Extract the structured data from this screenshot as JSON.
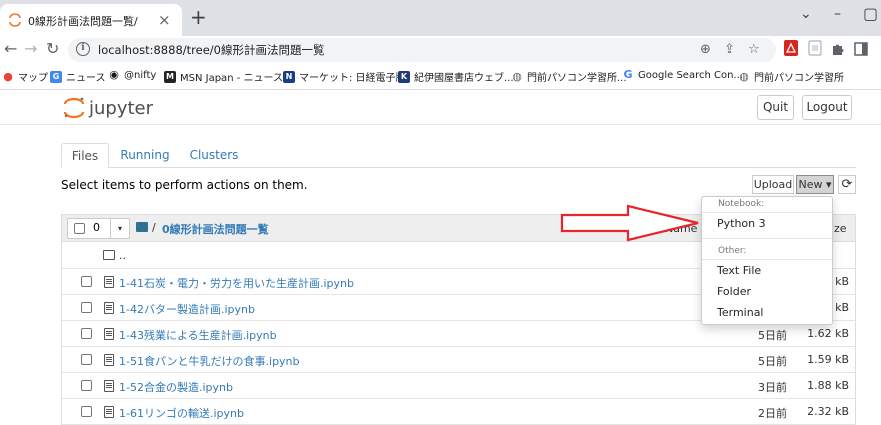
{
  "browser": {
    "tab_title": "0線形計画法問題一覧/",
    "close_glyph": "×",
    "new_tab_glyph": "+",
    "url": "localhost:8888/tree/0線形計画法問題一覧",
    "controls": {
      "minimize": "⌄",
      "minimize2": "–",
      "restore": "▢",
      "close": "×"
    },
    "bookmarks": [
      {
        "label": "マップ",
        "icon": "map-pin-icon",
        "color": "#ea4335"
      },
      {
        "label": "ニュース",
        "icon": "gn-news-icon",
        "color": "#4285f4"
      },
      {
        "label": "@nifty",
        "icon": "nifty-icon",
        "color": "#1a1a1a"
      },
      {
        "label": "MSN Japan - ニュース...",
        "icon": "msn-icon",
        "color": "#222222"
      },
      {
        "label": "マーケット: 日経電子版",
        "icon": "nikkei-icon",
        "color": "#183d8b"
      },
      {
        "label": "紀伊國屋書店ウェブ...",
        "icon": "kinokuniya-icon",
        "color": "#1f3b7a"
      },
      {
        "label": "門前パソコン学習所...",
        "icon": "globe-icon",
        "color": "#5f6368"
      },
      {
        "label": "Google Search Con...",
        "icon": "google-icon",
        "color": "#4285f4"
      },
      {
        "label": "門前パソコン学習所",
        "icon": "globe-icon",
        "color": "#5f6368"
      }
    ]
  },
  "jupyter": {
    "logo_text": "jupyter",
    "quit_label": "Quit",
    "logout_label": "Logout",
    "tabs": [
      {
        "label": "Files",
        "active": true
      },
      {
        "label": "Running",
        "active": false
      },
      {
        "label": "Clusters",
        "active": false
      }
    ],
    "select_message": "Select items to perform actions on them.",
    "upload_label": "Upload",
    "new_label": "New ▾",
    "refresh_glyph": "⟳",
    "header": {
      "selected_count": "0",
      "caret": "▾",
      "separator": "/",
      "folder_name": "0線形計画法問題一覧",
      "name_col": "Name ↓",
      "size_col": "ze"
    },
    "up_dir": "..",
    "files": [
      {
        "name": "1-41石炭・電力・労力を用いた生産計画.ipynb",
        "modified": "",
        "size": "kB"
      },
      {
        "name": "1-42バター製造計画.ipynb",
        "modified": "",
        "size": "kB"
      },
      {
        "name": "1-43残業による生産計画.ipynb",
        "modified": "5日前",
        "size": "1.62 kB"
      },
      {
        "name": "1-51食パンと牛乳だけの食事.ipynb",
        "modified": "5日前",
        "size": "1.59 kB"
      },
      {
        "name": "1-52合金の製造.ipynb",
        "modified": "3日前",
        "size": "1.88 kB"
      },
      {
        "name": "1-61リンゴの輸送.ipynb",
        "modified": "2日前",
        "size": "2.32 kB"
      }
    ],
    "new_menu": {
      "notebook_header": "Notebook:",
      "python_label": "Python 3",
      "other_header": "Other:",
      "items": [
        "Text File",
        "Folder",
        "Terminal"
      ]
    },
    "annotation_arrow_color": "#e8252a"
  }
}
